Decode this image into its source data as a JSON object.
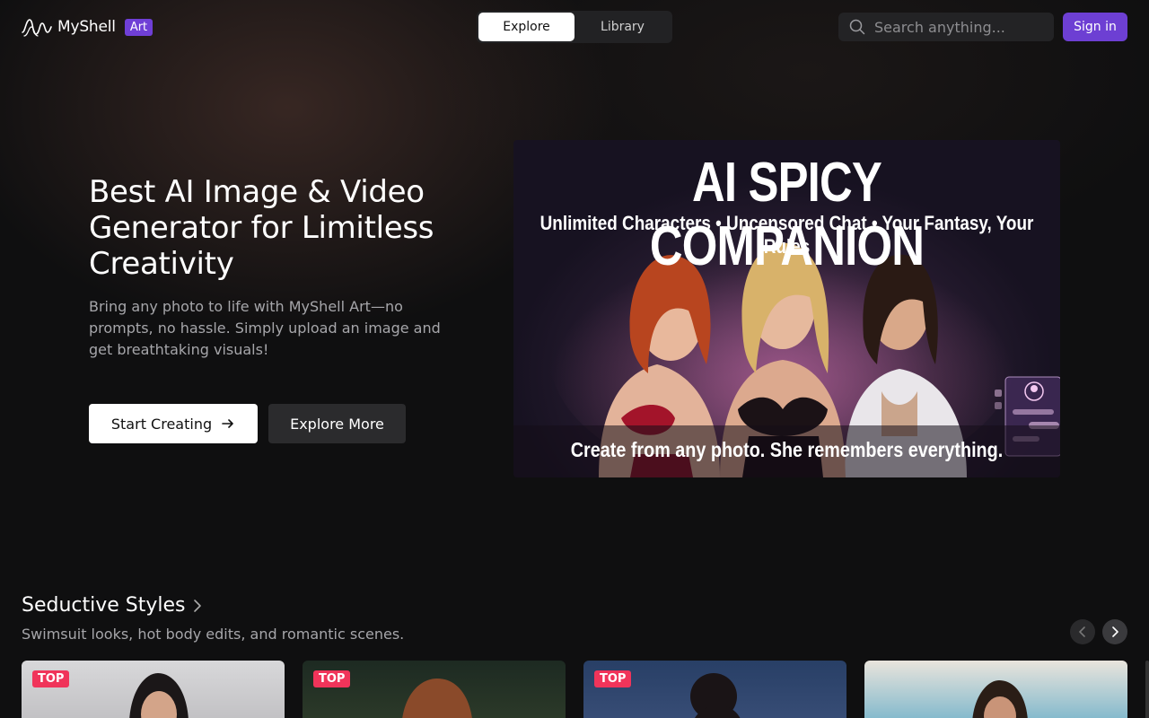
{
  "header": {
    "logo_text": "MyShell",
    "logo_badge": "Art",
    "tabs": [
      {
        "label": "Explore",
        "active": true
      },
      {
        "label": "Library",
        "active": false
      }
    ],
    "search_placeholder": "Search anything...",
    "sign_in": "Sign in"
  },
  "hero": {
    "title": "Best AI Image & Video Generator for Limitless Creativity",
    "subtitle": "Bring any photo to life with MyShell Art—no prompts, no hassle. Simply upload an image and get breathtaking visuals!",
    "primary_button": "Start Creating",
    "secondary_button": "Explore More"
  },
  "banner": {
    "title": "AI SPICY COMPANION",
    "subtitle": "Unlimited Characters • Uncensored Chat • Your Fantasy, Your Rules",
    "footer": "Create from any photo. She remembers everything."
  },
  "section": {
    "title": "Seductive Styles",
    "subtitle": "Swimsuit looks, hot body edits, and romantic scenes.",
    "cards": [
      {
        "badge": "TOP"
      },
      {
        "badge": "TOP"
      },
      {
        "badge": "TOP"
      },
      {
        "badge": ""
      }
    ]
  },
  "colors": {
    "background": "#0f0f10",
    "accent": "#6d3fd3",
    "badge": "#f0345a"
  }
}
